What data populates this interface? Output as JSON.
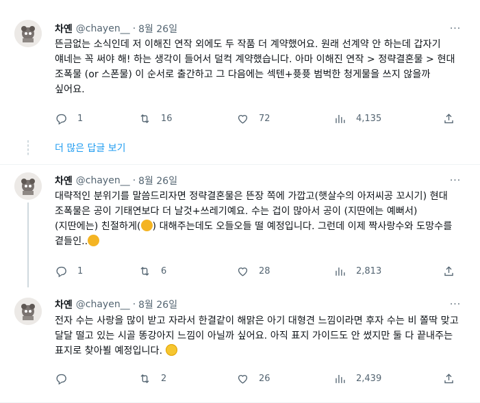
{
  "tweets": [
    {
      "name": "차옌",
      "handle": "@chayen__",
      "dot": "·",
      "date": "8월 26일",
      "text": "뜬금없는 소식인데 저 이해진 연작 외에도 두 작품 더 계약했어요. 원래 선계약 안 하는데 갑자기 얘네는 꼭 써야 해! 하는 생각이 들어서 덜컥 계약했습니다. 아마 이해진 연작 > 정략결혼물 > 현대 조폭물 (or 스폰물) 이 순서로 출간하고 그 다음에는 섹텐+퓻퓻 범벅한 청게물을 쓰지 않을까 싶어요.",
      "replies": "1",
      "retweets": "16",
      "likes": "72",
      "views": "4,135"
    },
    {
      "name": "차옌",
      "handle": "@chayen__",
      "dot": "·",
      "date": "8월 26일",
      "text_a": "대략적인 분위기를 말씀드리자면 정략결혼물은 뜬장 쪽에 가깝고(햇살수의 아저씨공 꼬시기) 현대 조폭물은 공이 기태연보다 더 날것+쓰레기예요. 수는 겁이 많아서 공이 (지딴에는 예뻐서) (지딴에는) 친절하게(",
      "text_b": ") 대해주는데도 오들오들 떨 예정입니다. 그런데 이제 짝사랑수와 도망수를 곁들인..",
      "replies": "1",
      "retweets": "6",
      "likes": "28",
      "views": "2,813"
    },
    {
      "name": "차옌",
      "handle": "@chayen__",
      "dot": "·",
      "date": "8월 26일",
      "text": "전자 수는 사랑을 많이 받고 자라서 한결같이 해맑은 아기 대형견 느낌이라면 후자 수는 비 쫄딱 맞고 달달 떨고 있는 시골 똥강아지 느낌이 아닐까 싶어요. 아직 표지 가이드도 안 썼지만 둘 다 끝내주는 표지로 찾아뵐 예정입니다.",
      "replies": "",
      "retweets": "2",
      "likes": "26",
      "views": "2,439"
    }
  ],
  "more_replies": "더 많은 답글 보기",
  "more_icon": "···",
  "icons": [
    "reply-icon",
    "retweet-icon",
    "like-icon",
    "views-icon",
    "share-icon",
    "more-icon",
    "hug-emoji",
    "halo-emoji"
  ],
  "colors": {
    "link": "#1d9bf0",
    "muted": "#536471",
    "text": "#0f1419",
    "divider": "#eff3f4"
  }
}
